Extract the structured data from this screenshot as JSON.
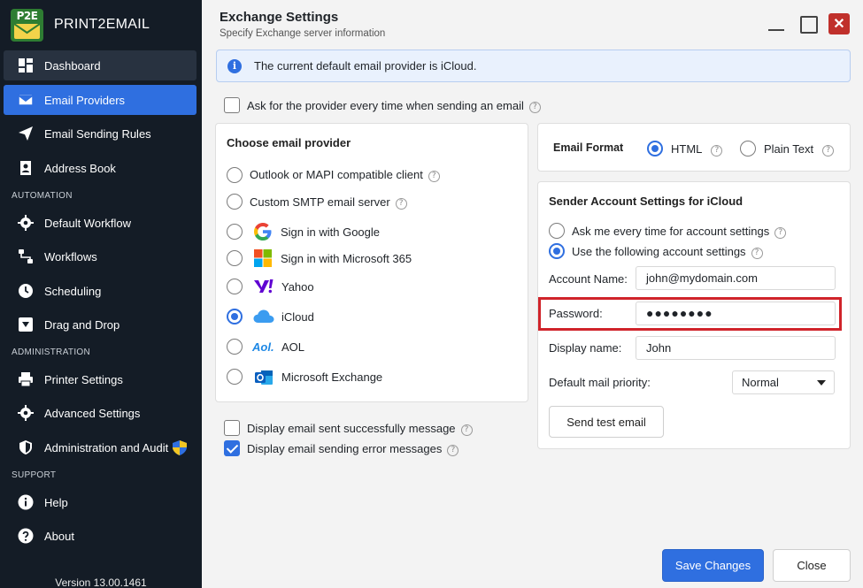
{
  "app": {
    "logo_text": "P2E",
    "name": "PRINT2EMAIL",
    "version": "Version 13.00.1461"
  },
  "sidebar": {
    "items": [
      {
        "label": "Dashboard",
        "icon": "dashboard-icon"
      },
      {
        "label": "Email Providers",
        "icon": "envelope-icon"
      },
      {
        "label": "Email Sending Rules",
        "icon": "paper-plane-icon"
      },
      {
        "label": "Address Book",
        "icon": "contact-book-icon"
      },
      {
        "label": "Default Workflow",
        "icon": "gear-icon"
      },
      {
        "label": "Workflows",
        "icon": "workflow-icon"
      },
      {
        "label": "Scheduling",
        "icon": "clock-icon"
      },
      {
        "label": "Drag and Drop",
        "icon": "drop-down-box-icon"
      },
      {
        "label": "Printer Settings",
        "icon": "printer-icon"
      },
      {
        "label": "Advanced Settings",
        "icon": "gear-icon"
      },
      {
        "label": "Administration and Audit",
        "icon": "shield-icon"
      },
      {
        "label": "Help",
        "icon": "info-icon"
      },
      {
        "label": "About",
        "icon": "question-icon"
      }
    ],
    "sections": {
      "automation": "AUTOMATION",
      "administration": "ADMINISTRATION",
      "support": "SUPPORT"
    }
  },
  "header": {
    "title": "Exchange Settings",
    "subtitle": "Specify Exchange server information",
    "close_glyph": "✕"
  },
  "info": {
    "text": "The current default email provider is iCloud.",
    "icon_glyph": "i"
  },
  "ask_provider": {
    "label": "Ask for the provider every time when sending an email",
    "checked": false
  },
  "help_glyph": "?",
  "providers": {
    "title": "Choose email provider",
    "items": [
      {
        "label": "Outlook or MAPI compatible client",
        "selected": false
      },
      {
        "label": "Custom SMTP email server",
        "selected": false
      },
      {
        "label": "Sign in with Google",
        "selected": false,
        "icon": "google-icon"
      },
      {
        "label": "Sign in with Microsoft 365",
        "selected": false,
        "icon": "microsoft-icon"
      },
      {
        "label": "Yahoo",
        "selected": false,
        "icon": "yahoo-icon"
      },
      {
        "label": "iCloud",
        "selected": true,
        "icon": "icloud-icon"
      },
      {
        "label": "AOL",
        "selected": false,
        "icon": "aol-icon"
      },
      {
        "label": "Microsoft Exchange",
        "selected": false,
        "icon": "outlook-icon"
      }
    ]
  },
  "options": {
    "success_msg": {
      "label": "Display email sent successfully message",
      "checked": false
    },
    "error_msg": {
      "label": "Display email sending error messages",
      "checked": true
    }
  },
  "format": {
    "label": "Email Format",
    "html": "HTML",
    "plain": "Plain Text",
    "selected": "HTML"
  },
  "sender": {
    "title": "Sender Account Settings for iCloud",
    "ask_each_time": "Ask me every time for account settings",
    "use_following": "Use the following account settings",
    "account_name_label": "Account Name:",
    "account_name": "john@mydomain.com",
    "password_label": "Password:",
    "password": "●●●●●●●●",
    "display_name_label": "Display name:",
    "display_name": "John",
    "priority_label": "Default mail priority:",
    "priority": "Normal",
    "test_button": "Send test email"
  },
  "footer": {
    "save": "Save Changes",
    "close": "Close"
  },
  "colors": {
    "accent": "#2f6fe0",
    "sidebar_bg": "#141c26",
    "highlight_red": "#d0232a"
  }
}
